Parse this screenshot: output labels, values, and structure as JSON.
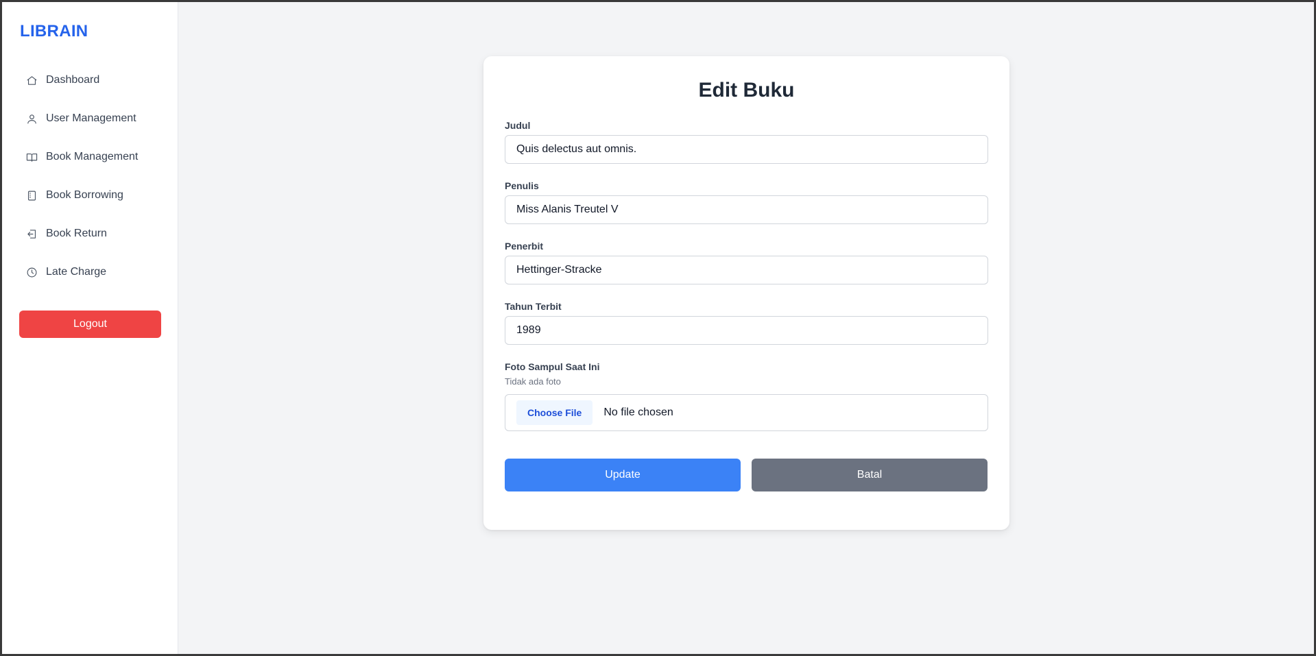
{
  "sidebar": {
    "brand": "LIBRAIN",
    "items": [
      {
        "label": "Dashboard",
        "icon": "home-icon"
      },
      {
        "label": "User Management",
        "icon": "user-icon"
      },
      {
        "label": "Book Management",
        "icon": "book-open-icon"
      },
      {
        "label": "Book Borrowing",
        "icon": "notebook-icon"
      },
      {
        "label": "Book Return",
        "icon": "return-icon"
      },
      {
        "label": "Late Charge",
        "icon": "clock-icon"
      }
    ],
    "logout_label": "Logout"
  },
  "form": {
    "title": "Edit Buku",
    "fields": {
      "judul": {
        "label": "Judul",
        "value": "Quis delectus aut omnis."
      },
      "penulis": {
        "label": "Penulis",
        "value": "Miss Alanis Treutel V"
      },
      "penerbit": {
        "label": "Penerbit",
        "value": "Hettinger-Stracke"
      },
      "tahun": {
        "label": "Tahun Terbit",
        "value": "1989"
      }
    },
    "cover": {
      "label": "Foto Sampul Saat Ini",
      "current": "Tidak ada foto",
      "choose_label": "Choose File",
      "status": "No file chosen"
    },
    "update_label": "Update",
    "cancel_label": "Batal"
  },
  "colors": {
    "brand": "#2563eb",
    "logout": "#ef4444",
    "update": "#3b82f6",
    "cancel": "#6b7280"
  }
}
